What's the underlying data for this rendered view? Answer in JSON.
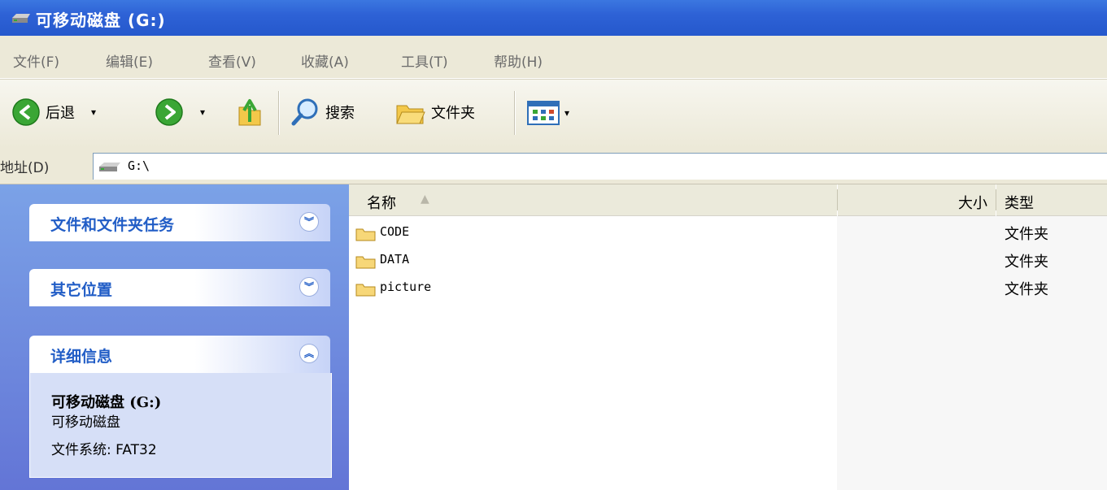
{
  "window": {
    "title": "可移动磁盘 (G:)",
    "icon": "drive-icon"
  },
  "menu": [
    "文件(F)",
    "编辑(E)",
    "查看(V)",
    "收藏(A)",
    "工具(T)",
    "帮助(H)"
  ],
  "toolbar": {
    "back_label": "后退",
    "search_label": "搜索",
    "folders_label": "文件夹"
  },
  "address": {
    "label": "地址(D)",
    "value": "G:\\"
  },
  "taskpane": {
    "panels": [
      {
        "title": "文件和文件夹任务",
        "state": "collapsed"
      },
      {
        "title": "其它位置",
        "state": "collapsed"
      },
      {
        "title": "详细信息",
        "state": "expanded"
      }
    ],
    "details": {
      "name": "可移动磁盘 (G:)",
      "type": "可移动磁盘",
      "filesystem": "文件系统: FAT32"
    }
  },
  "filelist": {
    "columns": {
      "name": "名称",
      "size": "大小",
      "type": "类型"
    },
    "rows": [
      {
        "name": "CODE",
        "size": "",
        "type": "文件夹"
      },
      {
        "name": "DATA",
        "size": "",
        "type": "文件夹"
      },
      {
        "name": "picture",
        "size": "",
        "type": "文件夹"
      }
    ]
  },
  "colors": {
    "titlebar": "#2e62d6",
    "taskpane": "#7ba2e7",
    "panel_title": "#215dc6",
    "menu_bg": "#ece9d8"
  }
}
